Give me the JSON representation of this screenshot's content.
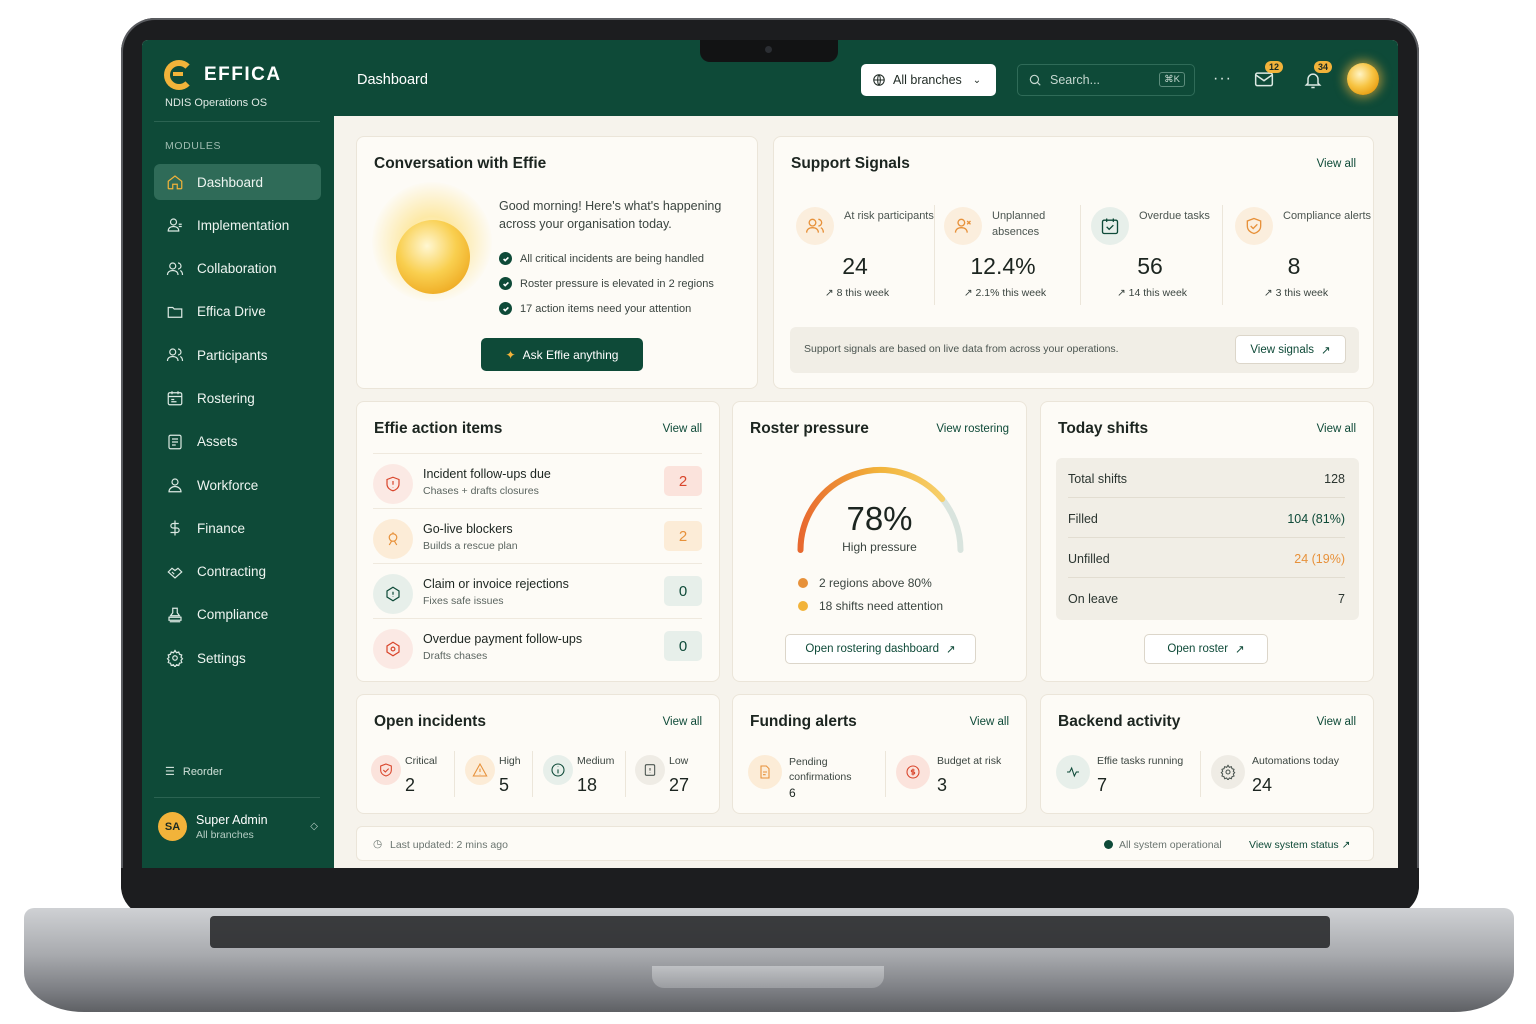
{
  "app": {
    "name": "EFFICA",
    "subtitle": "NDIS Operations OS"
  },
  "sidebar": {
    "section_label": "MODULES",
    "items": [
      {
        "label": "Dashboard",
        "icon": "home-icon"
      },
      {
        "label": "Implementation",
        "icon": "clipboard-user-icon"
      },
      {
        "label": "Collaboration",
        "icon": "users-icon"
      },
      {
        "label": "Effica Drive",
        "icon": "folder-icon"
      },
      {
        "label": "Participants",
        "icon": "people-icon"
      },
      {
        "label": "Rostering",
        "icon": "calendar-icon"
      },
      {
        "label": "Assets",
        "icon": "document-icon"
      },
      {
        "label": "Workforce",
        "icon": "person-icon"
      },
      {
        "label": "Finance",
        "icon": "dollar-icon"
      },
      {
        "label": "Contracting",
        "icon": "handshake-icon"
      },
      {
        "label": "Compliance",
        "icon": "stamp-icon"
      },
      {
        "label": "Settings",
        "icon": "gear-icon"
      }
    ],
    "reorder_label": "Reorder",
    "user": {
      "initials": "SA",
      "name": "Super Admin",
      "scope": "All branches"
    }
  },
  "topbar": {
    "title": "Dashboard",
    "branch_selector": "All branches",
    "search_placeholder": "Search...",
    "search_shortcut": "⌘K",
    "mail_badge": "12",
    "bell_badge": "34"
  },
  "conversation": {
    "title": "Conversation with Effie",
    "greeting": "Good morning! Here's what's happening across your organisation today.",
    "checks": [
      "All critical incidents are being handled",
      "Roster pressure is elevated in 2 regions",
      "17 action items need your attention"
    ],
    "ask_button": "Ask Effie anything"
  },
  "signals": {
    "title": "Support Signals",
    "view_all": "View  all",
    "items": [
      {
        "label": "At risk participants",
        "value": "24",
        "trend": "8 this week"
      },
      {
        "label": "Unplanned absences",
        "value": "12.4%",
        "trend": "2.1% this week"
      },
      {
        "label": "Overdue tasks",
        "value": "56",
        "trend": "14 this week"
      },
      {
        "label": "Compliance alerts",
        "value": "8",
        "trend": "3 this week"
      }
    ],
    "footer_note": "Support signals are based on live data from across your operations.",
    "footer_button": "View signals"
  },
  "action_items": {
    "title": "Effie action items",
    "view_all": "View  all",
    "rows": [
      {
        "title": "Incident follow-ups due",
        "sub": "Chases + drafts closures",
        "count": "2"
      },
      {
        "title": "Go-live blockers",
        "sub": "Builds a rescue plan",
        "count": "2"
      },
      {
        "title": "Claim or invoice rejections",
        "sub": "Fixes safe issues",
        "count": "0"
      },
      {
        "title": "Overdue payment follow-ups",
        "sub": "Drafts chases",
        "count": "0"
      }
    ]
  },
  "roster": {
    "title": "Roster pressure",
    "view_link": "View rostering",
    "percent": "78%",
    "percent_value": 78,
    "status": "High pressure",
    "legend": [
      "2 regions above 80%",
      "18 shifts need attention"
    ],
    "button": "Open rostering dashboard"
  },
  "shifts": {
    "title": "Today shifts",
    "view_all": "View  all",
    "rows": [
      {
        "label": "Total shifts",
        "value": "128"
      },
      {
        "label": "Filled",
        "value": "104 (81%)"
      },
      {
        "label": "Unfilled",
        "value": "24 (19%)"
      },
      {
        "label": "On leave",
        "value": "7"
      }
    ],
    "button": "Open roster"
  },
  "incidents": {
    "title": "Open incidents",
    "view_all": "View  all",
    "items": [
      {
        "label": "Critical",
        "value": "2"
      },
      {
        "label": "High",
        "value": "5"
      },
      {
        "label": "Medium",
        "value": "18"
      },
      {
        "label": "Low",
        "value": "27"
      }
    ]
  },
  "funding": {
    "title": "Funding alerts",
    "view_all": "View  all",
    "items": [
      {
        "label_line1": "Pending",
        "label_line2": "confirmations",
        "value": "6"
      },
      {
        "label": "Budget at risk",
        "value": "3"
      }
    ]
  },
  "backend": {
    "title": "Backend activity",
    "view_all": "View  all",
    "items": [
      {
        "label": "Effie tasks running",
        "value": "7"
      },
      {
        "label": "Automations today",
        "value": "24"
      }
    ]
  },
  "footer": {
    "updated": "Last updated: 2 mins ago",
    "status": "All system operational",
    "status_link": "View system status"
  },
  "colors": {
    "brand": "#0e4a38",
    "accent": "#f2b33a",
    "warning": "#e7913a",
    "danger": "#d9452b"
  }
}
